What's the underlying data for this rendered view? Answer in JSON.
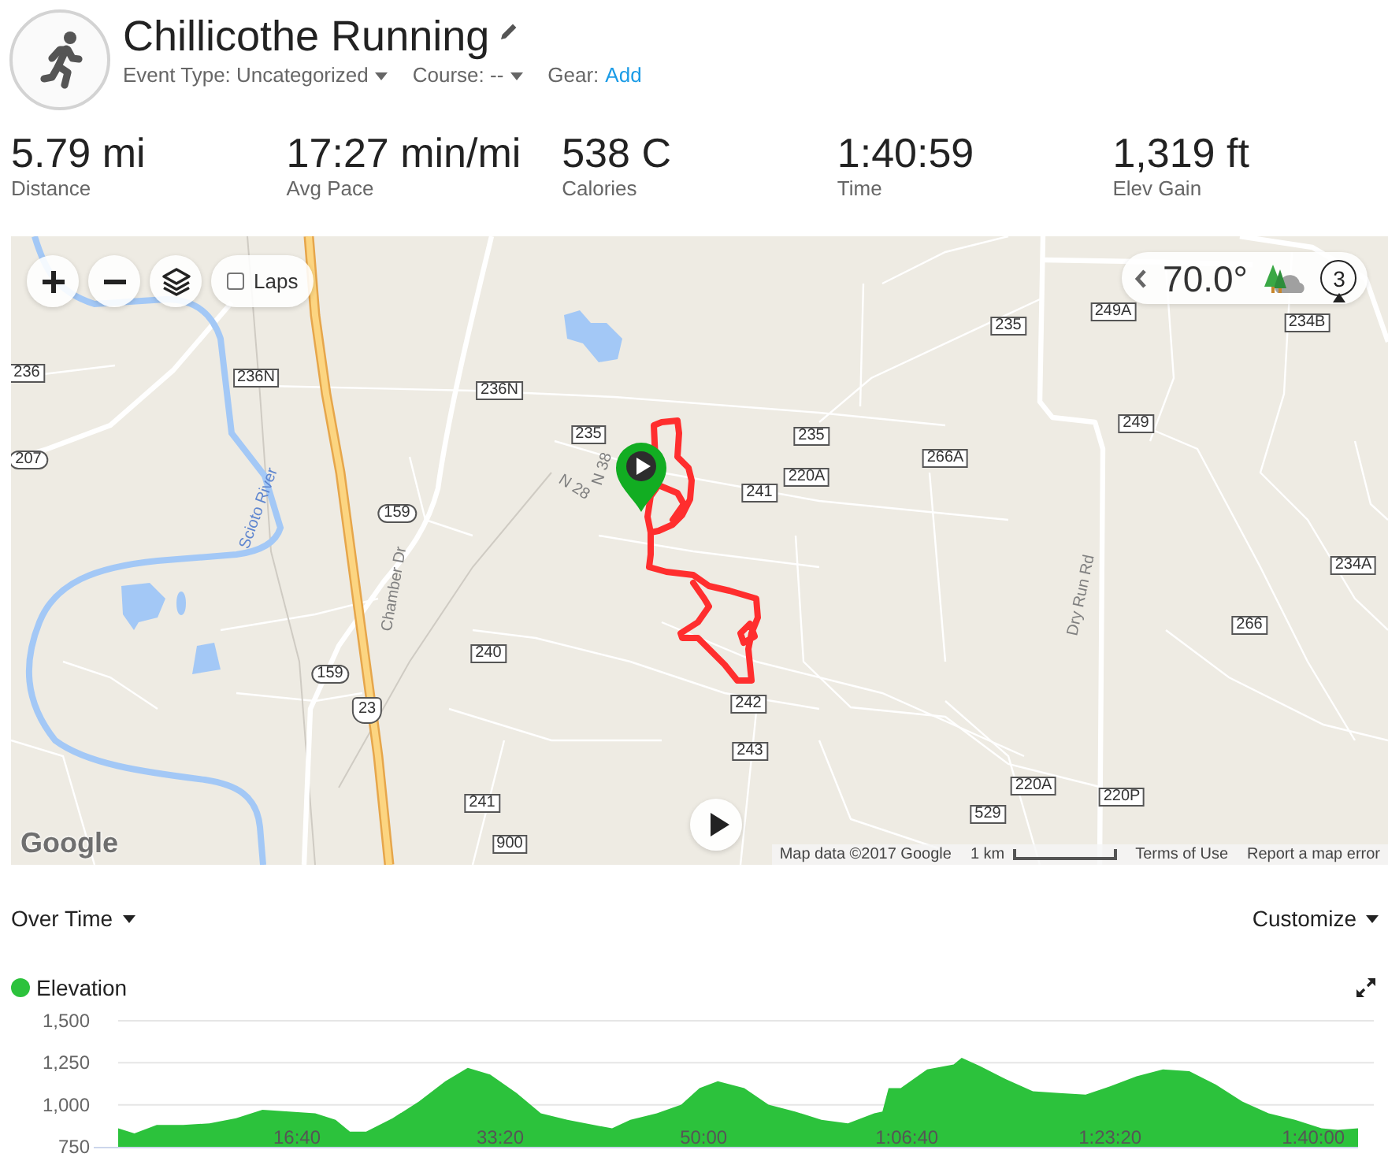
{
  "activity": {
    "title": "Chillicothe Running",
    "meta": [
      {
        "kind": "dropdown",
        "label": "Event Type:",
        "value": "Uncategorized"
      },
      {
        "kind": "dropdown",
        "label": "Course:",
        "value": "--"
      },
      {
        "kind": "link",
        "label": "Gear:",
        "value": "Add"
      }
    ]
  },
  "stats": [
    {
      "value": "5.79 mi",
      "label": "Distance"
    },
    {
      "value": "17:27 min/mi",
      "label": "Avg Pace"
    },
    {
      "value": "538 C",
      "label": "Calories"
    },
    {
      "value": "1:40:59",
      "label": "Time"
    },
    {
      "value": "1,319 ft",
      "label": "Elev Gain"
    }
  ],
  "map": {
    "laps": {
      "label": "Laps",
      "checked": false
    },
    "weather": {
      "temperature": "70.0°",
      "wind_speed": "3"
    },
    "labels": [
      {
        "kind": "county",
        "text": "249A"
      },
      {
        "kind": "county",
        "text": "235"
      },
      {
        "kind": "county",
        "text": "234B"
      },
      {
        "kind": "county",
        "text": "236"
      },
      {
        "kind": "county",
        "text": "236N"
      },
      {
        "kind": "county",
        "text": "236N"
      },
      {
        "kind": "county",
        "text": "249"
      },
      {
        "kind": "county",
        "text": "235"
      },
      {
        "kind": "county",
        "text": "235"
      },
      {
        "kind": "county",
        "text": "266A"
      },
      {
        "kind": "state",
        "text": "207"
      },
      {
        "kind": "street",
        "text": "N 38"
      },
      {
        "kind": "county",
        "text": "220A"
      },
      {
        "kind": "county",
        "text": "241"
      },
      {
        "kind": "street",
        "text": "N 28"
      },
      {
        "kind": "state",
        "text": "159"
      },
      {
        "kind": "river",
        "text": "Scioto River"
      },
      {
        "kind": "county",
        "text": "234A"
      },
      {
        "kind": "street",
        "text": "Chamber Dr"
      },
      {
        "kind": "street",
        "text": "Dry Run Rd"
      },
      {
        "kind": "county",
        "text": "266"
      },
      {
        "kind": "county",
        "text": "240"
      },
      {
        "kind": "state",
        "text": "159"
      },
      {
        "kind": "county",
        "text": "242"
      },
      {
        "kind": "us",
        "text": "23"
      },
      {
        "kind": "county",
        "text": "243"
      },
      {
        "kind": "county",
        "text": "220A"
      },
      {
        "kind": "county",
        "text": "220P"
      },
      {
        "kind": "county",
        "text": "241"
      },
      {
        "kind": "county",
        "text": "529"
      },
      {
        "kind": "county",
        "text": "900"
      }
    ],
    "logo": "Google",
    "attribution": {
      "data": "Map data ©2017 Google",
      "scale": "1 km",
      "terms": "Terms of Use",
      "report": "Report a map error"
    }
  },
  "chart_panel": {
    "view": "Over Time",
    "customize": "Customize",
    "chart_data": {
      "type": "area",
      "x": [
        120,
        200,
        310,
        440,
        570,
        700,
        830,
        960,
        1090,
        1190,
        1260,
        1340,
        1470,
        1600,
        1730,
        1840,
        1950,
        2080,
        2200,
        2330,
        2460,
        2550,
        2640,
        2770,
        2890,
        2980,
        3070,
        3200,
        3320,
        3450,
        3580,
        3710,
        3840,
        3880,
        3910,
        3970,
        4100,
        4230,
        4270,
        4360,
        4490,
        4620,
        4750,
        4880,
        5000,
        5130,
        5260,
        5390,
        5520,
        5650,
        5780,
        5910,
        6040,
        6120,
        6220
      ],
      "series": [
        {
          "name": "Elevation",
          "color": "#2cc23c",
          "values": [
            860,
            830,
            880,
            880,
            890,
            920,
            970,
            960,
            950,
            910,
            840,
            840,
            920,
            1020,
            1140,
            1220,
            1180,
            1070,
            950,
            910,
            880,
            860,
            910,
            950,
            1000,
            1100,
            1140,
            1100,
            1000,
            960,
            910,
            890,
            950,
            960,
            1100,
            1100,
            1210,
            1240,
            1280,
            1230,
            1150,
            1080,
            1070,
            1060,
            1110,
            1170,
            1210,
            1200,
            1120,
            1020,
            950,
            910,
            860,
            850,
            860
          ]
        }
      ],
      "xlim": [
        0,
        6220
      ],
      "ylim": [
        750,
        1500
      ],
      "xticks": [
        {
          "value": 1000,
          "label": "16:40"
        },
        {
          "value": 2000,
          "label": "33:20"
        },
        {
          "value": 3000,
          "label": "50:00"
        },
        {
          "value": 4000,
          "label": "1:06:40"
        },
        {
          "value": 5000,
          "label": "1:23:20"
        },
        {
          "value": 6000,
          "label": "1:40:00"
        }
      ],
      "yticks": [
        {
          "value": 750,
          "label": "750"
        },
        {
          "value": 1000,
          "label": "1,000"
        },
        {
          "value": 1250,
          "label": "1,250"
        },
        {
          "value": 1500,
          "label": "1,500"
        }
      ]
    }
  }
}
